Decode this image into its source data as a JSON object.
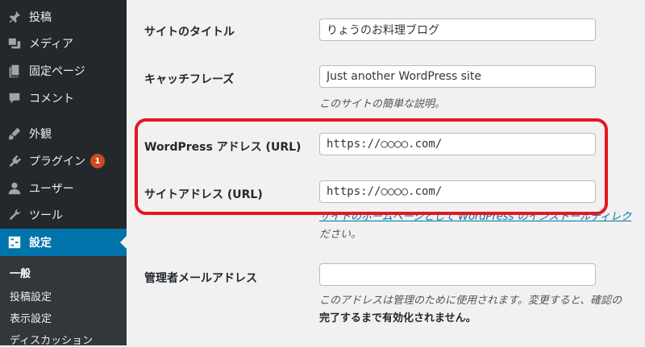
{
  "sidebar": {
    "items": [
      {
        "label": "投稿",
        "icon": "pin-icon"
      },
      {
        "label": "メディア",
        "icon": "media-icon"
      },
      {
        "label": "固定ページ",
        "icon": "pages-icon"
      },
      {
        "label": "コメント",
        "icon": "comments-icon"
      },
      {
        "label": "外観",
        "icon": "appearance-icon"
      },
      {
        "label": "プラグイン",
        "icon": "plugins-icon",
        "badge": "1"
      },
      {
        "label": "ユーザー",
        "icon": "users-icon"
      },
      {
        "label": "ツール",
        "icon": "tools-icon"
      },
      {
        "label": "設定",
        "icon": "settings-icon",
        "active": true
      }
    ],
    "submenu": [
      "一般",
      "投稿設定",
      "表示設定",
      "ディスカッション"
    ]
  },
  "form": {
    "site_title": {
      "label": "サイトのタイトル",
      "value": "りょうのお料理ブログ"
    },
    "tagline": {
      "label": "キャッチフレーズ",
      "value": "Just another WordPress site",
      "description": "このサイトの簡単な説明。"
    },
    "wp_address": {
      "label": "WordPress アドレス (URL)",
      "value": "https://○○○○.com/"
    },
    "site_address": {
      "label": "サイトアドレス (URL)",
      "value": "https://○○○○.com/",
      "description_link": "サイトのホームページとして WordPress のインストールディレク",
      "description_tail": "ださい。"
    },
    "admin_email": {
      "label": "管理者メールアドレス",
      "value": "",
      "description": "このアドレスは管理のために使用されます。変更すると、確認の",
      "description_bold": "完了するまで有効化されません。"
    }
  },
  "colors": {
    "sidebar": "#23282d",
    "active": "#0073aa",
    "highlight": "#e4171f",
    "badge": "#ca4a1f"
  }
}
